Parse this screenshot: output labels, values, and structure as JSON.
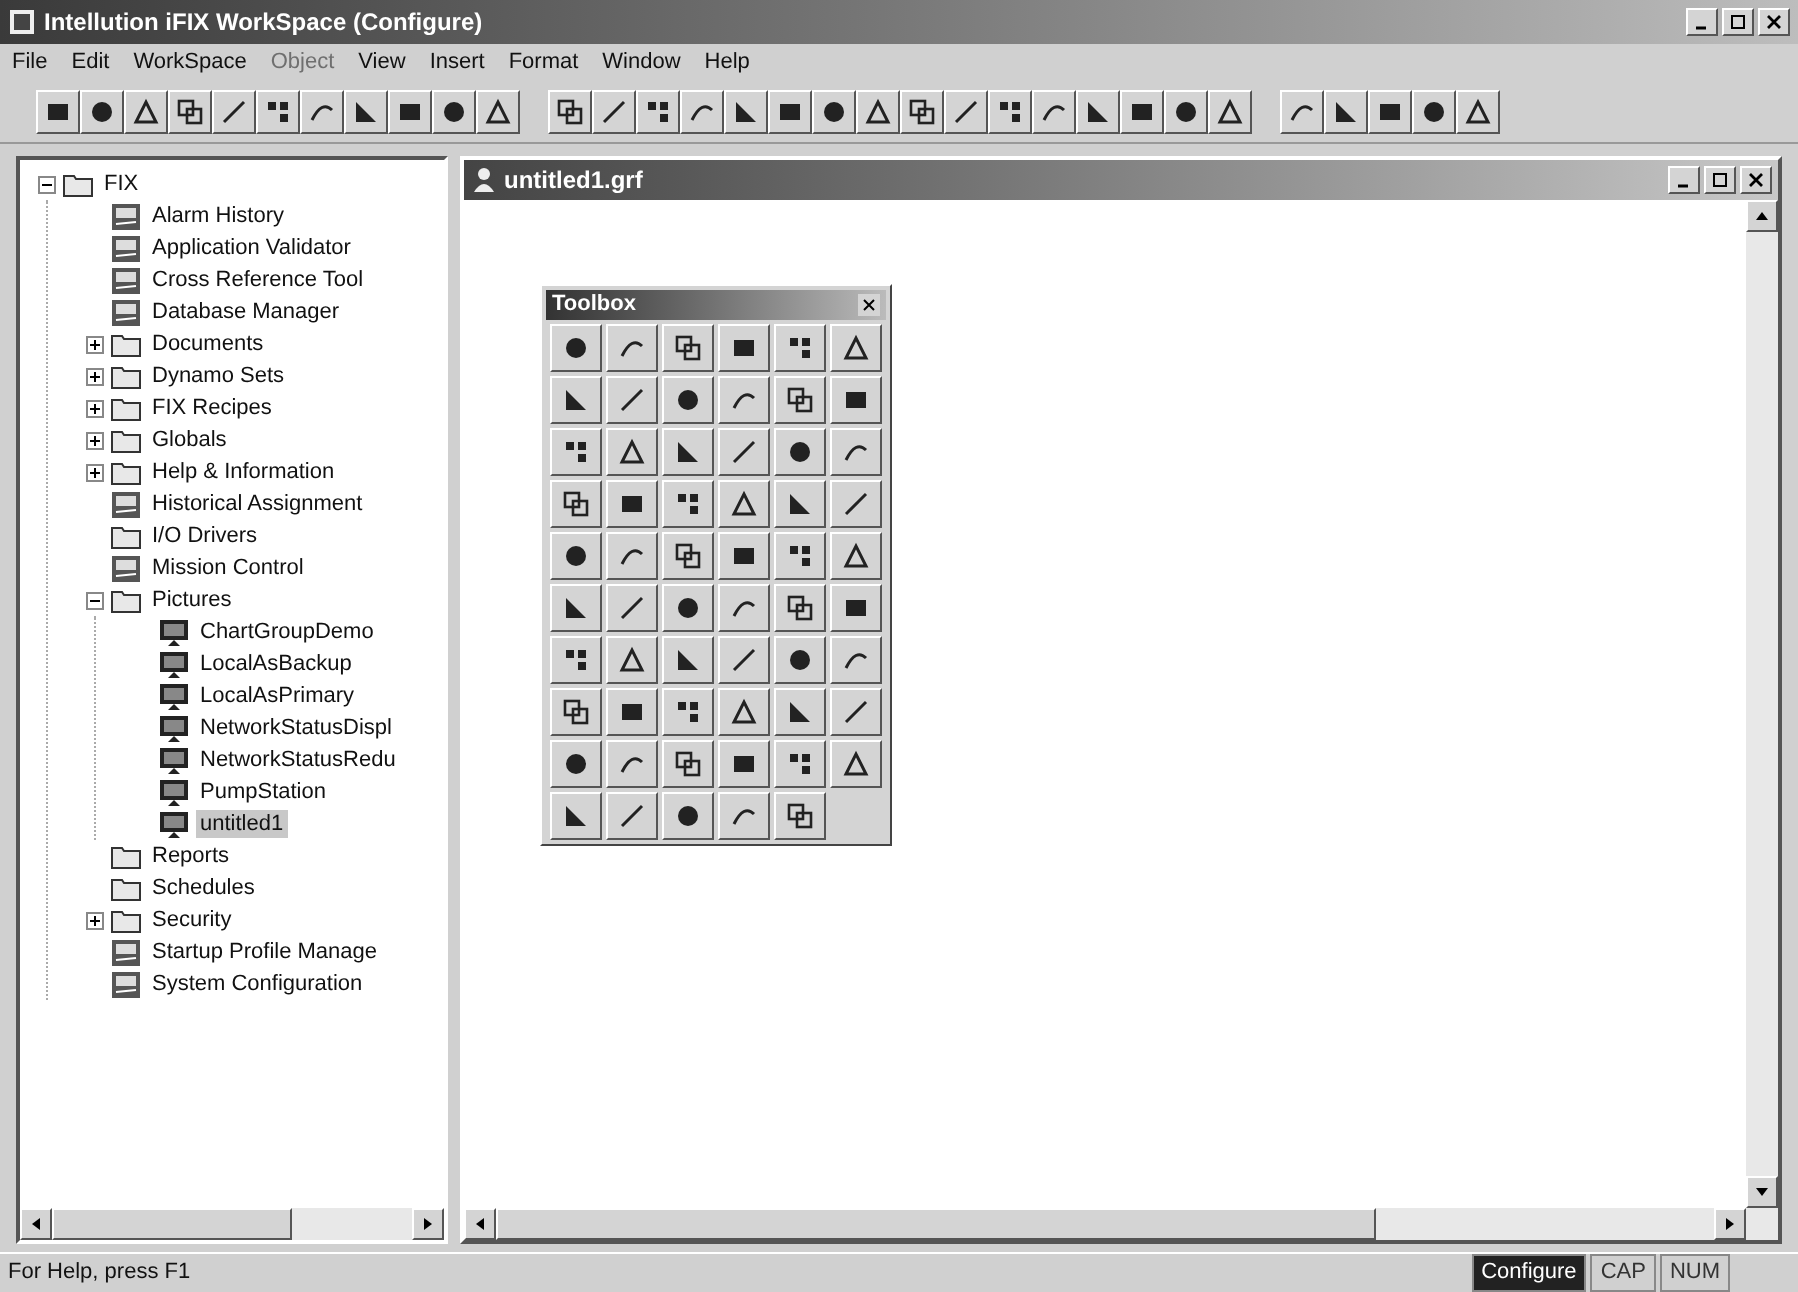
{
  "window": {
    "title": "Intellution iFIX WorkSpace (Configure)"
  },
  "menu": [
    {
      "label": "File",
      "disabled": false
    },
    {
      "label": "Edit",
      "disabled": false
    },
    {
      "label": "WorkSpace",
      "disabled": false
    },
    {
      "label": "Object",
      "disabled": true
    },
    {
      "label": "View",
      "disabled": false
    },
    {
      "label": "Insert",
      "disabled": false
    },
    {
      "label": "Format",
      "disabled": false
    },
    {
      "label": "Window",
      "disabled": false
    },
    {
      "label": "Help",
      "disabled": false
    }
  ],
  "tree": [
    {
      "label": "FIX",
      "kind": "folder",
      "expanded": true,
      "selected": false,
      "children": [
        {
          "label": "Alarm History",
          "kind": "app",
          "selected": false
        },
        {
          "label": "Application Validator",
          "kind": "app",
          "selected": false
        },
        {
          "label": "Cross Reference Tool",
          "kind": "app",
          "selected": false
        },
        {
          "label": "Database Manager",
          "kind": "app",
          "selected": false
        },
        {
          "label": "Documents",
          "kind": "folder",
          "expanded": false,
          "selected": false
        },
        {
          "label": "Dynamo Sets",
          "kind": "folder",
          "expanded": false,
          "selected": false
        },
        {
          "label": "FIX Recipes",
          "kind": "folder",
          "expanded": false,
          "selected": false
        },
        {
          "label": "Globals",
          "kind": "folder",
          "expanded": false,
          "selected": false
        },
        {
          "label": "Help & Information",
          "kind": "folder",
          "expanded": false,
          "selected": false
        },
        {
          "label": "Historical Assignment",
          "kind": "app",
          "selected": false
        },
        {
          "label": "I/O Drivers",
          "kind": "folder",
          "selected": false
        },
        {
          "label": "Mission Control",
          "kind": "app",
          "selected": false
        },
        {
          "label": "Pictures",
          "kind": "folder",
          "expanded": true,
          "selected": false,
          "children": [
            {
              "label": "ChartGroupDemo",
              "kind": "picture",
              "selected": false
            },
            {
              "label": "LocalAsBackup",
              "kind": "picture",
              "selected": false
            },
            {
              "label": "LocalAsPrimary",
              "kind": "picture",
              "selected": false
            },
            {
              "label": "NetworkStatusDispl",
              "kind": "picture",
              "selected": false
            },
            {
              "label": "NetworkStatusRedu",
              "kind": "picture",
              "selected": false
            },
            {
              "label": "PumpStation",
              "kind": "picture",
              "selected": false
            },
            {
              "label": "untitled1",
              "kind": "picture",
              "selected": true
            }
          ]
        },
        {
          "label": "Reports",
          "kind": "folder",
          "selected": false
        },
        {
          "label": "Schedules",
          "kind": "folder",
          "selected": false
        },
        {
          "label": "Security",
          "kind": "folder",
          "expanded": false,
          "selected": false
        },
        {
          "label": "Startup Profile Manage",
          "kind": "app",
          "selected": false
        },
        {
          "label": "System Configuration",
          "kind": "app",
          "selected": false
        }
      ]
    }
  ],
  "document": {
    "title": "untitled1.grf"
  },
  "toolbox": {
    "title": "Toolbox"
  },
  "status_bar": {
    "text": "For Help, press F1",
    "indicators": [
      {
        "label": "Configure",
        "on": true
      },
      {
        "label": "CAP",
        "on": false
      },
      {
        "label": "NUM",
        "on": false
      }
    ]
  }
}
